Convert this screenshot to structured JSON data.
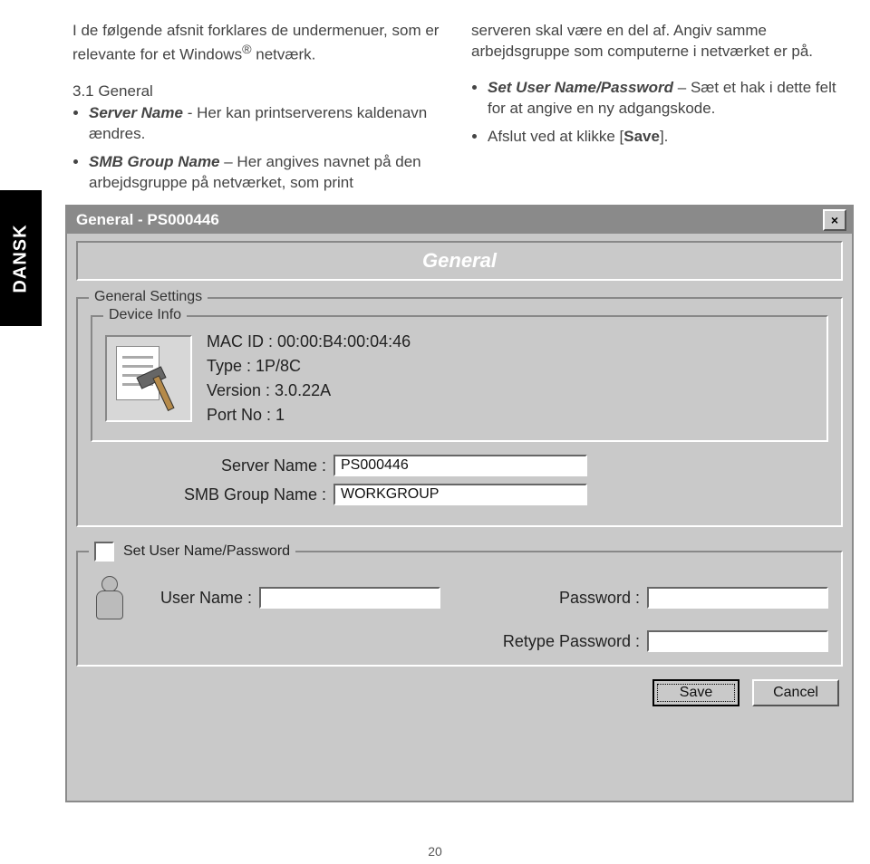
{
  "sideTab": "DANSK",
  "left": {
    "intro_a": "I de følgende afsnit forklares de undermenuer, som er relevante for et Windows",
    "reg": "®",
    "intro_b": " netværk.",
    "sect": "3.1 General",
    "b1_label": "Server Name",
    "b1_text": " - Her kan printserverens kaldenavn ændres.",
    "b2_label": "SMB Group Name",
    "b2_text": " – Her angives navnet på den arbejdsgruppe på netværket, som print"
  },
  "right": {
    "cont": "serveren skal være en del af. Angiv samme arbejdsgruppe som computerne i netværket er på.",
    "b1_label": "Set User Name/Password",
    "b1_text": " – Sæt et hak i dette felt for at angive en ny adgangskode.",
    "b2_a": "Afslut ved at klikke [",
    "b2_bold": "Save",
    "b2_b": "]."
  },
  "dialog": {
    "title": "General - PS000446",
    "close": "×",
    "band": "General",
    "group1_legend": "General Settings",
    "device_legend": "Device Info",
    "mac": "MAC ID : 00:00:B4:00:04:46",
    "type": "Type : 1P/8C",
    "version": "Version : 3.0.22A",
    "port": "Port No : 1",
    "server_label": "Server Name :",
    "server_value": "PS000446",
    "smb_label": "SMB Group Name :",
    "smb_value": "WORKGROUP",
    "chk_label": "Set User Name/Password",
    "user_label": "User Name :",
    "user_value": "",
    "pass_label": "Password :",
    "pass_value": "",
    "retype_label": "Retype Password :",
    "retype_value": "",
    "save": "Save",
    "cancel": "Cancel"
  },
  "pageNumber": "20"
}
